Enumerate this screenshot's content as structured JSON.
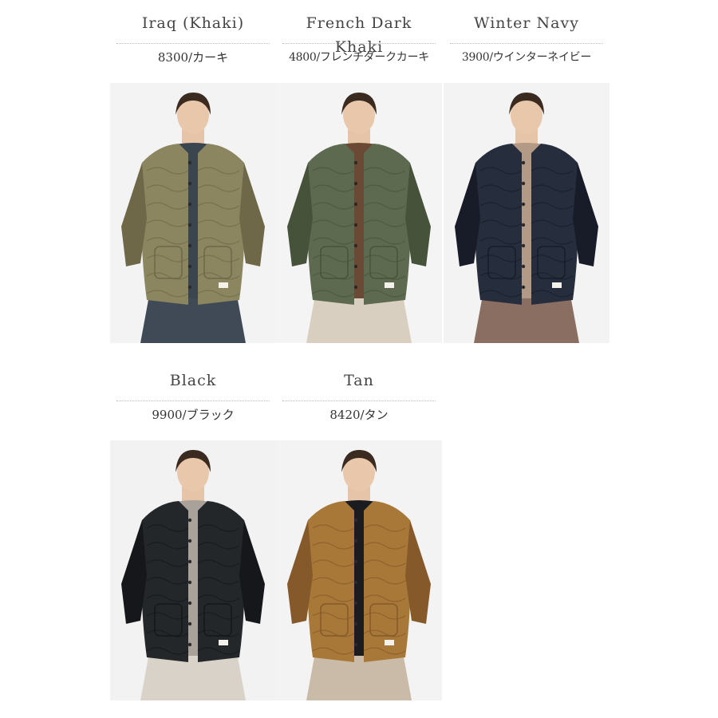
{
  "swatches": [
    {
      "name": "Iraq (Khaki)",
      "code": "8300/カーキ",
      "jacket": "#8b8560",
      "jacket_dark": "#6e6848",
      "inner": "#3b4550",
      "bottom": "#3f4a56",
      "bg": "#f3f3f3"
    },
    {
      "name": "French Dark Khaki",
      "code": "4800/フレンチダークカーキ",
      "jacket": "#5e6a50",
      "jacket_dark": "#47523b",
      "inner": "#6a4a34",
      "bottom": "#d9cfc0",
      "bg": "#f4f4f4"
    },
    {
      "name": "Winter Navy",
      "code": "3900/ウインターネイビー",
      "jacket": "#262d3c",
      "jacket_dark": "#171c28",
      "inner": "#b39a86",
      "bottom": "#8a6e62",
      "bg": "#f3f3f3"
    },
    {
      "name": "Black",
      "code": "9900/ブラック",
      "jacket": "#24272a",
      "jacket_dark": "#15171a",
      "inner": "#a8a29a",
      "bottom": "#d8d2c8",
      "bg": "#f2f2f2"
    },
    {
      "name": "Tan",
      "code": "8420/タン",
      "jacket": "#a87838",
      "jacket_dark": "#86592a",
      "inner": "#1b1c20",
      "bottom": "#c9bba8",
      "bg": "#f3f3f3"
    }
  ]
}
